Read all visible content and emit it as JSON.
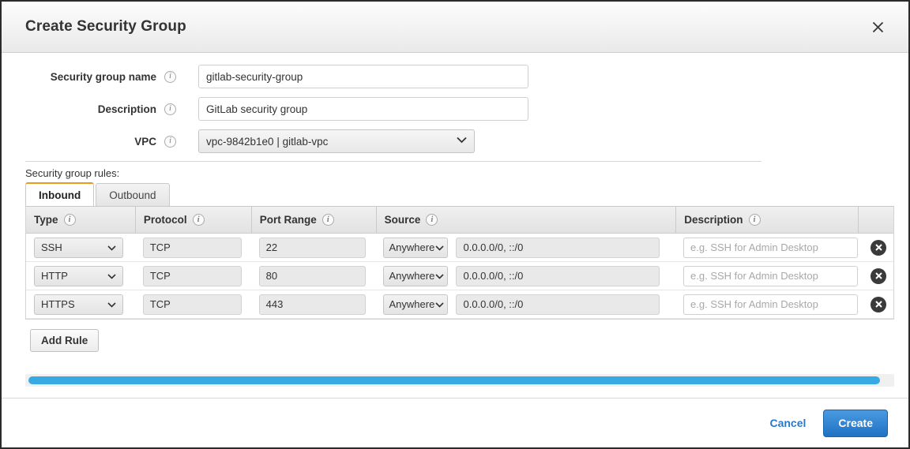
{
  "dialog": {
    "title": "Create Security Group",
    "close_icon": "close-icon"
  },
  "form": {
    "fields": [
      {
        "label": "Security group name",
        "value": "gitlab-security-group",
        "info_icon": "info-icon"
      },
      {
        "label": "Description",
        "value": "GitLab security group",
        "info_icon": "info-icon"
      },
      {
        "label": "VPC",
        "value": "vpc-9842b1e0 | gitlab-vpc",
        "info_icon": "info-icon",
        "caret_icon": "chevron-down-icon"
      }
    ]
  },
  "rules": {
    "section_label": "Security group rules:",
    "tabs": [
      {
        "label": "Inbound",
        "active": true
      },
      {
        "label": "Outbound",
        "active": false
      }
    ],
    "columns": [
      {
        "label": "Type",
        "info_icon": "info-icon"
      },
      {
        "label": "Protocol",
        "info_icon": "info-icon"
      },
      {
        "label": "Port Range",
        "info_icon": "info-icon"
      },
      {
        "label": "Source",
        "info_icon": "info-icon"
      },
      {
        "label": "Description",
        "info_icon": "info-icon"
      },
      {
        "label": ""
      }
    ],
    "rows": [
      {
        "type": "SSH",
        "protocol": "TCP",
        "port_range": "22",
        "source_scope": "Anywhere",
        "source_cidr": "0.0.0.0/0, ::/0",
        "description": "",
        "description_placeholder": "e.g. SSH for Admin Desktop",
        "delete_icon": "delete-circle-icon"
      },
      {
        "type": "HTTP",
        "protocol": "TCP",
        "port_range": "80",
        "source_scope": "Anywhere",
        "source_cidr": "0.0.0.0/0, ::/0",
        "description": "",
        "description_placeholder": "e.g. SSH for Admin Desktop",
        "delete_icon": "delete-circle-icon"
      },
      {
        "type": "HTTPS",
        "protocol": "TCP",
        "port_range": "443",
        "source_scope": "Anywhere",
        "source_cidr": "0.0.0.0/0, ::/0",
        "description": "",
        "description_placeholder": "e.g. SSH for Admin Desktop",
        "delete_icon": "delete-circle-icon"
      }
    ],
    "add_rule_label": "Add Rule"
  },
  "scrollbar": {
    "name": "horizontal-scrollbar",
    "color": "#38aae3"
  },
  "footer": {
    "cancel_label": "Cancel",
    "create_label": "Create"
  },
  "colors": {
    "accent_tab": "#ec9c1c",
    "primary_button": "#1f72c4",
    "link": "#2a78c8",
    "scroll_thumb": "#38aae3"
  }
}
